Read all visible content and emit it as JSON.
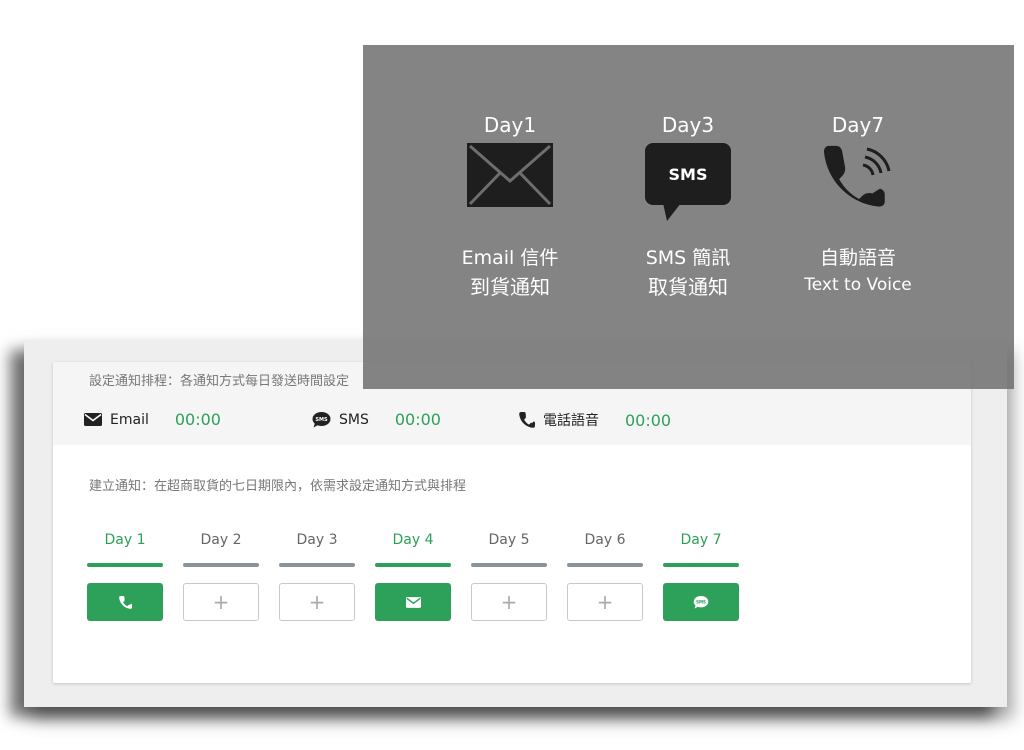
{
  "schedule": {
    "title": "設定通知排程：各通知方式每日發送時間設定",
    "email_label": "Email",
    "email_time": "00:00",
    "sms_label": "SMS",
    "sms_time": "00:00",
    "voice_label": "電話語音",
    "voice_time": "00:00"
  },
  "create": {
    "title": "建立通知：在超商取貨的七日期限內，依需求設定通知方式與排程"
  },
  "days": [
    {
      "label": "Day 1",
      "active": true,
      "slot": "phone-icon"
    },
    {
      "label": "Day 2",
      "active": false,
      "slot": "add"
    },
    {
      "label": "Day 3",
      "active": false,
      "slot": "add"
    },
    {
      "label": "Day 4",
      "active": true,
      "slot": "envelope-icon"
    },
    {
      "label": "Day 5",
      "active": false,
      "slot": "add"
    },
    {
      "label": "Day 6",
      "active": false,
      "slot": "add"
    },
    {
      "label": "Day 7",
      "active": true,
      "slot": "sms-icon"
    }
  ],
  "add_symbol": "+",
  "sms_icon_text": "SMS",
  "overlay": {
    "cols": [
      {
        "day": "Day1",
        "line1": "Email 信件",
        "line2": "到貨通知",
        "icon": "envelope-icon"
      },
      {
        "day": "Day3",
        "line1": "SMS 簡訊",
        "line2": "取貨通知",
        "icon": "sms-bubble-icon",
        "icon_text": "SMS"
      },
      {
        "day": "Day7",
        "line1": "自動語音",
        "line2": "Text to Voice",
        "icon": "phone-icon"
      }
    ]
  },
  "colors": {
    "accent": "#2da05a",
    "inactive_bar": "#8a9399",
    "overlay": "#6e6e6e"
  }
}
